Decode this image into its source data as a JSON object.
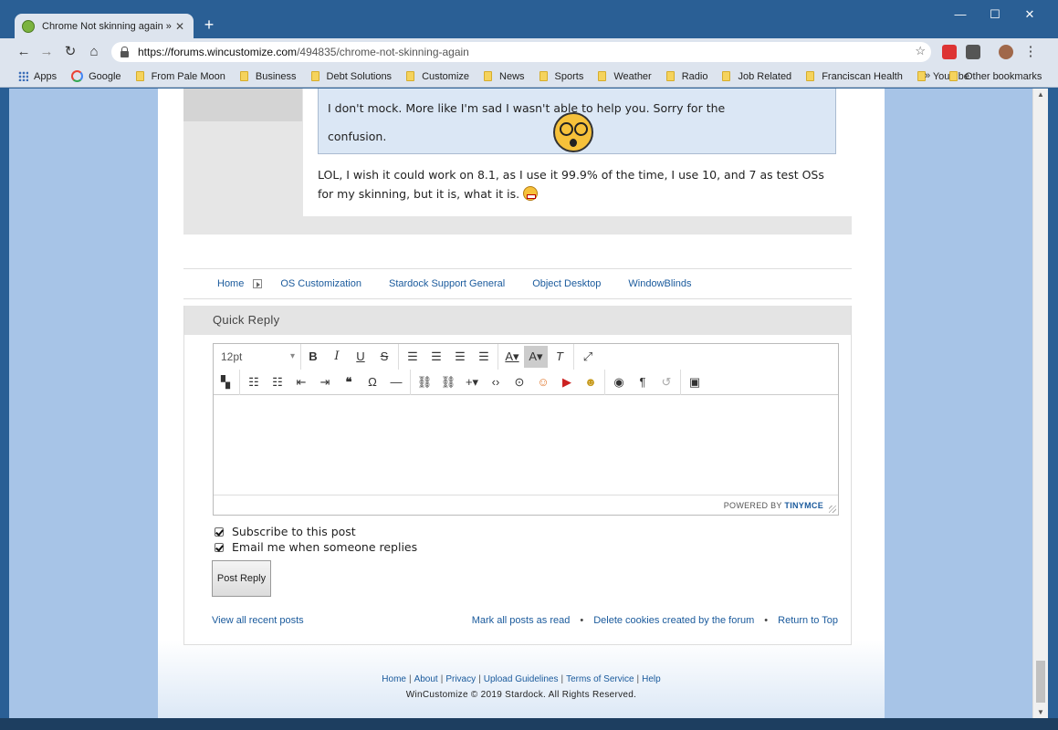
{
  "browser": {
    "tab_title": "Chrome Not skinning again » Fo",
    "tab_close": "✕",
    "new_tab": "+",
    "url_domain": "https://forums.wincustomize.com",
    "url_path": "/494835/chrome-not-skinning-again",
    "window_controls": {
      "minimize": "—",
      "maximize": "☐",
      "close": "✕"
    }
  },
  "bookmarks": {
    "apps": "Apps",
    "google": "Google",
    "folders": [
      "From Pale Moon",
      "Business",
      "Debt Solutions",
      "Customize",
      "News",
      "Sports",
      "Weather",
      "Radio",
      "Job Related",
      "Franciscan Health",
      "Youtube"
    ],
    "more": "»",
    "other": "Other bookmarks"
  },
  "post": {
    "quote_line1": "I don't mock. More like I'm sad I wasn't able to help you. Sorry for the",
    "quote_line2": "confusion.",
    "reply": "LOL, I wish it could work on 8.1, as I use it 99.9% of the time, I use 10, and 7 as test OSs for my skinning, but it is, what it is."
  },
  "breadcrumbs": [
    "Home",
    "OS Customization",
    "Stardock Support General",
    "Object Desktop",
    "WindowBlinds"
  ],
  "quick_reply": {
    "heading": "Quick Reply",
    "font_size": "12pt",
    "powered_by": "POWERED BY",
    "tinymce": "TINYMCE",
    "subscribe_label": "Subscribe to this post",
    "email_label": "Email me when someone replies",
    "post_button": "Post Reply",
    "view_recent": "View all recent posts",
    "mark_read": "Mark all posts as read",
    "delete_cookies": "Delete cookies created by the forum",
    "return_top": "Return to Top",
    "dot": "•"
  },
  "footer": {
    "links": [
      "Home",
      "About",
      "Privacy",
      "Upload Guidelines",
      "Terms of Service",
      "Help"
    ],
    "copyright": "WinCustomize © 2019 Stardock. All Rights Reserved."
  }
}
